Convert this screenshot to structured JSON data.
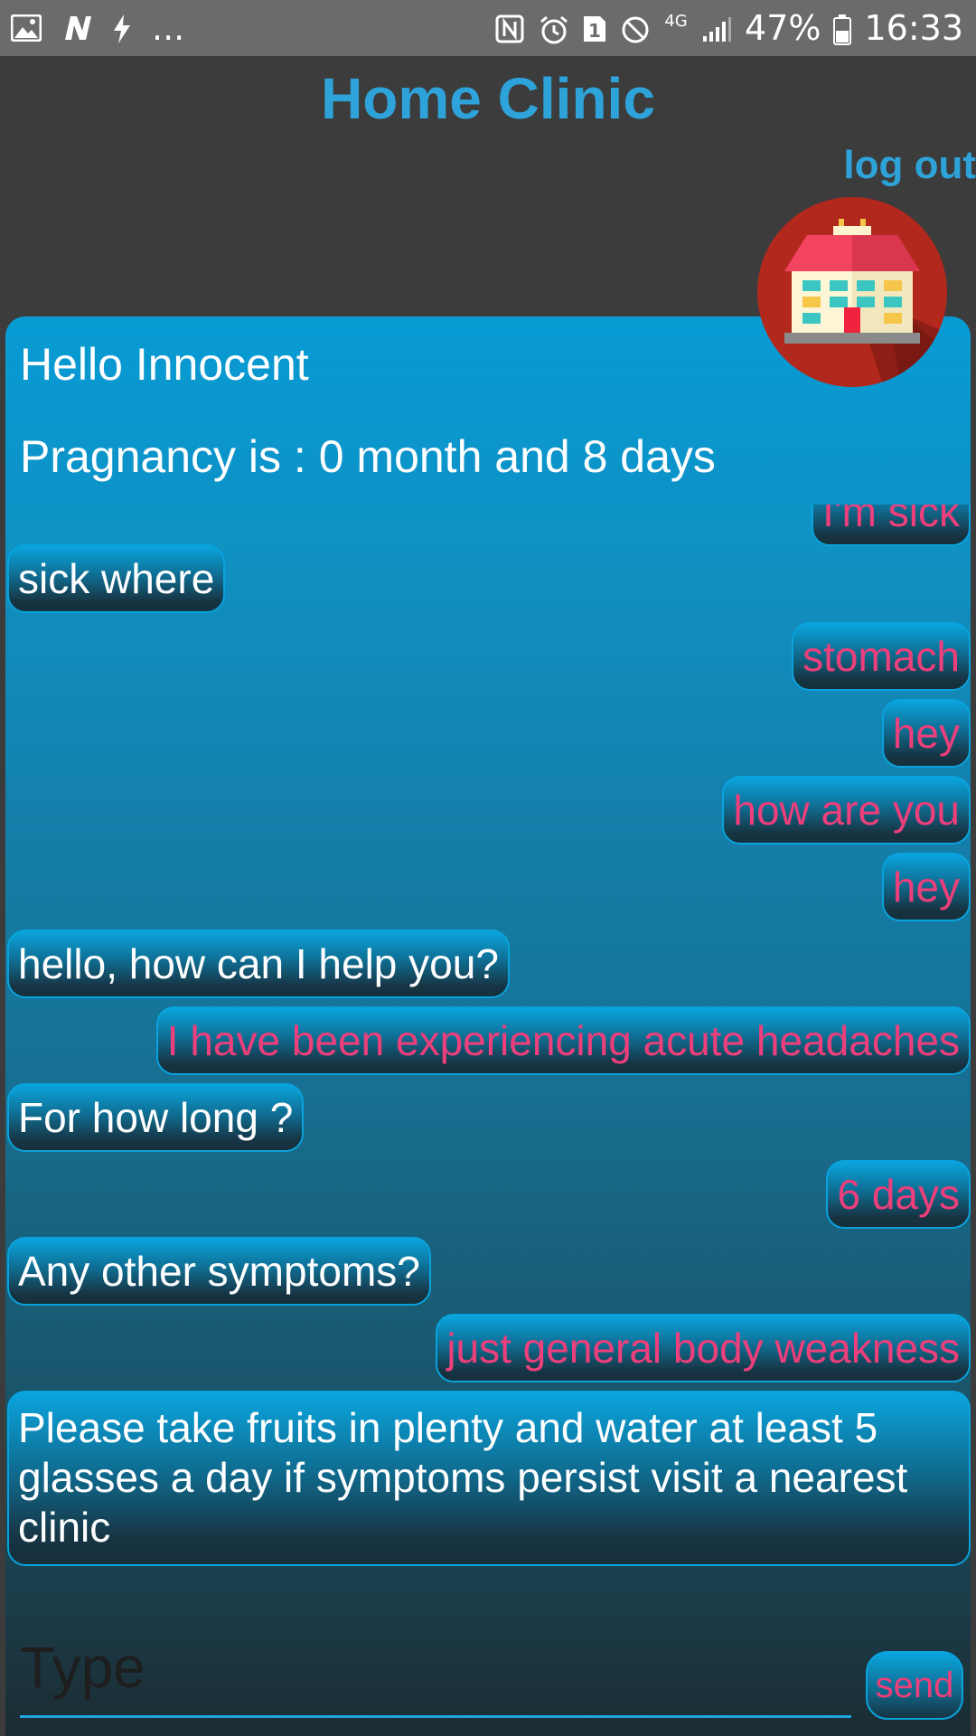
{
  "status_bar": {
    "notification_more": "...",
    "battery": "47%",
    "time": "16:33",
    "network": "4G"
  },
  "header": {
    "title": "Home Clinic",
    "logout_label": "log out"
  },
  "panel": {
    "greeting": "Hello Innocent",
    "pregnancy_text": "Pragnancy is : 0 month and 8 days"
  },
  "chat": {
    "messages": [
      {
        "sender": "user",
        "text": "I'm sick"
      },
      {
        "sender": "clinic",
        "text": "sick where"
      },
      {
        "sender": "user",
        "text": "stomach"
      },
      {
        "sender": "user",
        "text": "hey"
      },
      {
        "sender": "user",
        "text": "how are you"
      },
      {
        "sender": "user",
        "text": "hey"
      },
      {
        "sender": "clinic",
        "text": "hello, how can I help you?"
      },
      {
        "sender": "user",
        "text": "I have been experiencing acute headaches"
      },
      {
        "sender": "clinic",
        "text": "For how long ?"
      },
      {
        "sender": "user",
        "text": "6 days"
      },
      {
        "sender": "clinic",
        "text": "Any other symptoms?"
      },
      {
        "sender": "user",
        "text": "just general body weakness"
      },
      {
        "sender": "clinic",
        "text": "Please take fruits in plenty and water at least 5 glasses a day if symptoms persist visit a nearest clinic"
      }
    ]
  },
  "composer": {
    "placeholder": "Type",
    "send_label": "send"
  },
  "colors": {
    "accent": "#2ea3da",
    "user_text": "#ec3f7b",
    "clinic_text": "#ffffff",
    "background": "#3c3c3c"
  },
  "icons": [
    "image-icon",
    "n-app-icon",
    "flash-icon",
    "nfc-icon",
    "alarm-icon",
    "sim-icon",
    "do-not-disturb-icon",
    "signal-icon",
    "battery-icon",
    "clinic-logo-icon"
  ]
}
